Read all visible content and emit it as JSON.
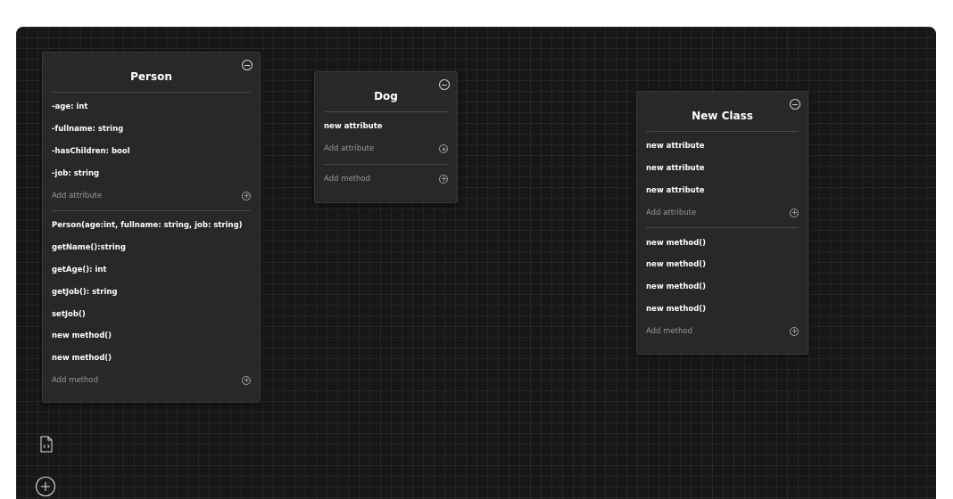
{
  "classes": [
    {
      "title": "Person",
      "attributes": [
        "-age: int",
        "-fullname: string",
        "-hasChildren: bool",
        "-job: string"
      ],
      "add_attribute_label": "Add attribute",
      "methods": [
        "Person(age:int, fullname: string, job: string)",
        "getName():string",
        "getAge(): int",
        "getJob(): string",
        "setJob()",
        "new method()",
        "new method()"
      ],
      "add_method_label": "Add method"
    },
    {
      "title": "Dog",
      "attributes": [
        "new attribute"
      ],
      "add_attribute_label": "Add attribute",
      "methods": [],
      "add_method_label": "Add method"
    },
    {
      "title": "New Class",
      "attributes": [
        "new attribute",
        "new attribute",
        "new attribute"
      ],
      "add_attribute_label": "Add attribute",
      "methods": [
        "new method()",
        "new method()",
        "new method()",
        "new method()"
      ],
      "add_method_label": "Add method"
    }
  ],
  "toolbar": {
    "code_icon": "code-file-icon",
    "add_icon": "plus-circle-icon"
  },
  "colors": {
    "canvas_bg": "#171717",
    "card_bg": "#282828",
    "muted_text": "#9a9a9a"
  }
}
